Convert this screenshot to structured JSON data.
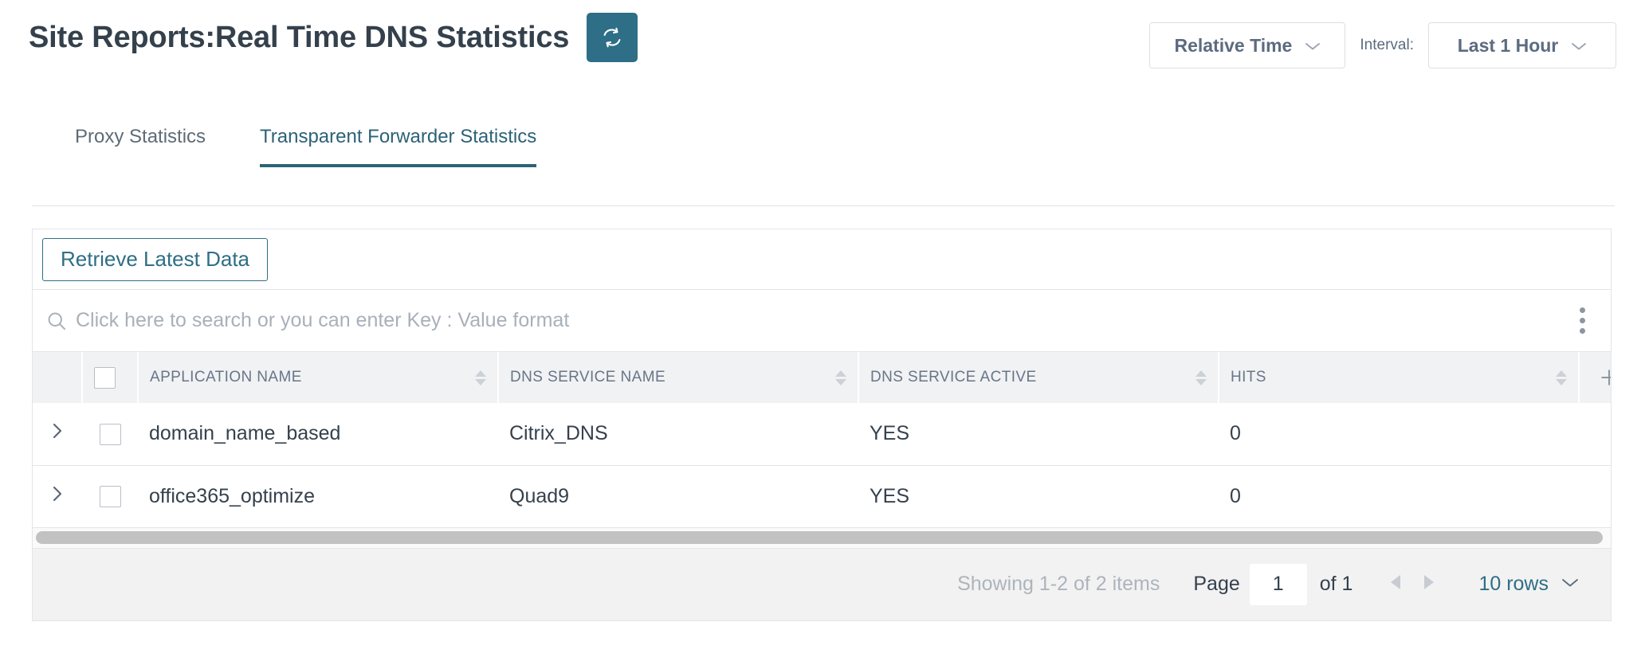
{
  "header": {
    "title": "Site Reports:Real Time DNS Statistics",
    "refresh_icon": "refresh-icon",
    "accent_color": "#2e6e86",
    "relative_time_label": "Relative Time",
    "interval_prefix": "Interval:",
    "interval_value": "Last 1 Hour"
  },
  "tabs": [
    {
      "label": "Proxy Statistics",
      "active": false
    },
    {
      "label": "Transparent Forwarder Statistics",
      "active": true
    }
  ],
  "toolbar": {
    "retrieve_label": "Retrieve Latest Data"
  },
  "search": {
    "icon": "search-icon",
    "placeholder": "Click here to search or you can enter Key : Value format",
    "value": "",
    "menu_icon": "kebab-menu-icon"
  },
  "table": {
    "columns": [
      {
        "label": "APPLICATION NAME",
        "sortable": true
      },
      {
        "label": "DNS SERVICE NAME",
        "sortable": true
      },
      {
        "label": "DNS SERVICE ACTIVE",
        "sortable": true
      },
      {
        "label": "HITS",
        "sortable": true
      }
    ],
    "add_column_icon": "plus-icon",
    "rows": [
      {
        "application_name": "domain_name_based",
        "dns_service_name": "Citrix_DNS",
        "dns_service_active": "YES",
        "hits": "0"
      },
      {
        "application_name": "office365_optimize",
        "dns_service_name": "Quad9",
        "dns_service_active": "YES",
        "hits": "0"
      }
    ]
  },
  "footer": {
    "showing": "Showing 1-2 of 2 items",
    "page_label": "Page",
    "page_value": "1",
    "of_label": "of 1",
    "prev_icon": "caret-left-icon",
    "next_icon": "caret-right-icon",
    "rows_per_page": "10 rows"
  }
}
